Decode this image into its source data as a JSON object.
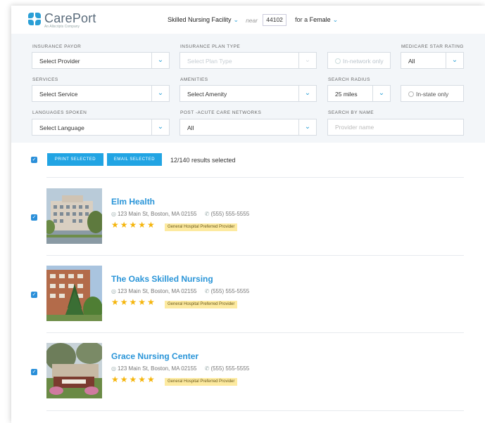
{
  "header": {
    "logo_name": "CarePort",
    "logo_sub": "An Allscripts Company",
    "facility_type": "Skilled Nursing Facility",
    "near_label": "near",
    "zip": "44102",
    "gender_prefix": "for a",
    "gender_value": "Female"
  },
  "filters": {
    "insurance_payor": {
      "label": "INSURANCE PAYOR",
      "value": "Select Provider"
    },
    "insurance_plan_type": {
      "label": "INSURANCE PLAN TYPE",
      "value": "Select Plan Type"
    },
    "in_network": {
      "label": "In-network only"
    },
    "medicare_star": {
      "label": "MEDICARE STAR RATING",
      "value": "All"
    },
    "services": {
      "label": "SERVICES",
      "value": "Select Service"
    },
    "amenities": {
      "label": "AMENITIES",
      "value": "Select Amenity"
    },
    "search_radius": {
      "label": "SEARCH RADIUS",
      "value": "25 miles"
    },
    "in_state": {
      "label": "In-state only"
    },
    "languages": {
      "label": "LANGUAGES SPOKEN",
      "value": "Select Language"
    },
    "post_acute": {
      "label": "POST -ACUTE CARE NETWORKS",
      "value": "All"
    },
    "search_name": {
      "label": "SEARCH BY NAME",
      "placeholder": "Provider name"
    }
  },
  "actions": {
    "print_label": "PRINT SELECTED",
    "email_label": "EMAIL SELECTED",
    "count_text": "12/140 results selected"
  },
  "results": [
    {
      "name": "Elm Health",
      "address": "123 Main St, Boston, MA 02155",
      "phone": "(555) 555-5555",
      "rating": 5,
      "stars": "★★★★★",
      "badge": "General Hospital Preferred Provider"
    },
    {
      "name": "The Oaks Skilled Nursing",
      "address": "123 Main St, Boston, MA 02155",
      "phone": "(555) 555-5555",
      "rating": 5,
      "stars": "★★★★★",
      "badge": "General Hospital Preferred Provider"
    },
    {
      "name": "Grace Nursing Center",
      "address": "123 Main St, Boston, MA 02155",
      "phone": "(555) 555-5555",
      "rating": 5,
      "stars": "★★★★★",
      "badge": "General Hospital Preferred Provider"
    }
  ],
  "colors": {
    "accent": "#21a4e3",
    "link": "#2a95d8",
    "star": "#f5b50c",
    "badge_bg": "#fdeaa0",
    "filter_bg": "#f3f6f9"
  }
}
